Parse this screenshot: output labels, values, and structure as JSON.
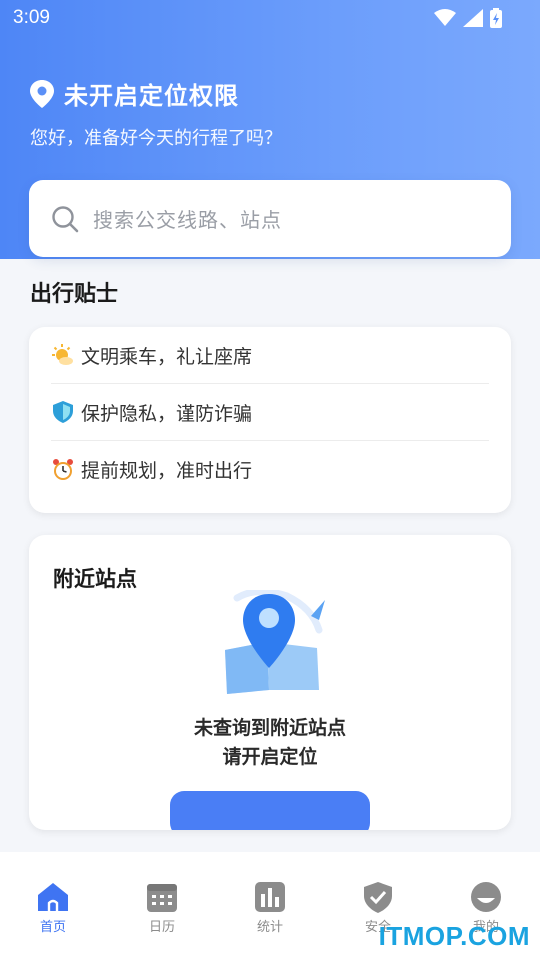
{
  "status": {
    "time": "3:09"
  },
  "header": {
    "location_title": "未开启定位权限",
    "greeting": "您好，准备好今天的行程了吗？"
  },
  "search": {
    "placeholder": "搜索公交线路、站点"
  },
  "tips": {
    "heading": "出行贴士",
    "items": [
      {
        "icon": "sun-emoji-icon",
        "text": "文明乘车，礼让座席"
      },
      {
        "icon": "shield-icon",
        "text": "保护隐私，谨防诈骗"
      },
      {
        "icon": "alarm-clock-icon",
        "text": "提前规划，准时出行"
      }
    ]
  },
  "nearby": {
    "title": "附近站点",
    "empty_line1": "未查询到附近站点",
    "empty_line2": "请开启定位"
  },
  "tabbar": {
    "items": [
      {
        "label": "首页",
        "icon": "home-icon",
        "active": true
      },
      {
        "label": "日历",
        "icon": "calendar-icon",
        "active": false
      },
      {
        "label": "统计",
        "icon": "bar-chart-icon",
        "active": false
      },
      {
        "label": "安全",
        "icon": "shield-check-icon",
        "active": false
      },
      {
        "label": "我的",
        "icon": "profile-icon",
        "active": false
      }
    ]
  },
  "watermark": "ITMOP.COM",
  "colors": {
    "primary": "#4a7ef5",
    "hero_start": "#4e86f6",
    "hero_end": "#7ba9fd",
    "tab_active": "#3f74f2"
  }
}
